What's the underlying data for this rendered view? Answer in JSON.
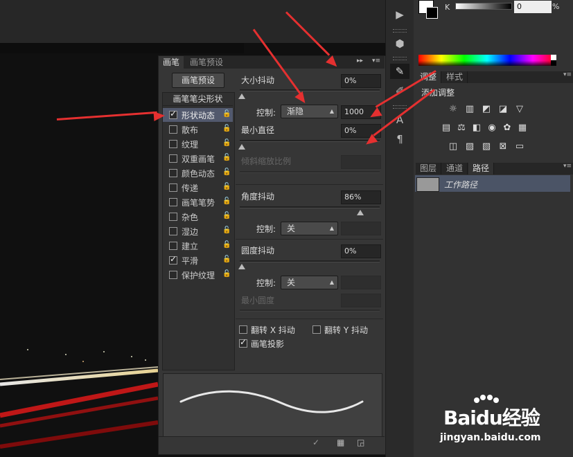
{
  "colors": {
    "panel_bg": "#363636",
    "selected_row": "#52596d",
    "arrow": "#e53030"
  },
  "color_panel": {
    "channel_label": "K",
    "value": "0",
    "unit": "%"
  },
  "adjust_panel": {
    "tabs": [
      {
        "label": "调整",
        "active": true
      },
      {
        "label": "样式",
        "active": false
      }
    ],
    "title": "添加调整"
  },
  "layers_panel": {
    "tabs": [
      {
        "label": "图层",
        "active": false
      },
      {
        "label": "通道",
        "active": false
      },
      {
        "label": "路径",
        "active": true
      }
    ],
    "path_name": "工作路径"
  },
  "brush_panel": {
    "tabs": [
      {
        "label": "画笔",
        "active": true
      },
      {
        "label": "画笔预设",
        "active": false
      }
    ],
    "preset_button": "画笔预设",
    "list_header": "画笔笔尖形状",
    "items": [
      {
        "label": "形状动态",
        "checked": true,
        "selected": true
      },
      {
        "label": "散布",
        "checked": false,
        "selected": false
      },
      {
        "label": "纹理",
        "checked": false,
        "selected": false
      },
      {
        "label": "双重画笔",
        "checked": false,
        "selected": false
      },
      {
        "label": "颜色动态",
        "checked": false,
        "selected": false
      },
      {
        "label": "传递",
        "checked": false,
        "selected": false
      },
      {
        "label": "画笔笔势",
        "checked": false,
        "selected": false
      },
      {
        "label": "杂色",
        "checked": false,
        "selected": false
      },
      {
        "label": "湿边",
        "checked": false,
        "selected": false
      },
      {
        "label": "建立",
        "checked": false,
        "selected": false
      },
      {
        "label": "平滑",
        "checked": true,
        "selected": false
      },
      {
        "label": "保护纹理",
        "checked": false,
        "selected": false
      }
    ],
    "size_jitter": {
      "label": "大小抖动",
      "value": "0%"
    },
    "size_control": {
      "label": "控制:",
      "value": "渐隐",
      "steps": "1000"
    },
    "min_diameter": {
      "label": "最小直径",
      "value": "0%"
    },
    "tilt_scale": {
      "label": "倾斜缩放比例"
    },
    "angle_jitter": {
      "label": "角度抖动",
      "value": "86%",
      "level": 0.86
    },
    "angle_control": {
      "label": "控制:",
      "value": "关"
    },
    "roundness_jitter": {
      "label": "圆度抖动",
      "value": "0%"
    },
    "roundness_control": {
      "label": "控制:",
      "value": "关"
    },
    "min_roundness": {
      "label": "最小圆度"
    },
    "flip_x": {
      "label": "翻转 X 抖动",
      "checked": false
    },
    "flip_y": {
      "label": "翻转 Y 抖动",
      "checked": false
    },
    "brush_projection": {
      "label": "画笔投影",
      "checked": true
    }
  },
  "watermark": {
    "brand": "Baidu经验",
    "url": "jingyan.baidu.com"
  }
}
